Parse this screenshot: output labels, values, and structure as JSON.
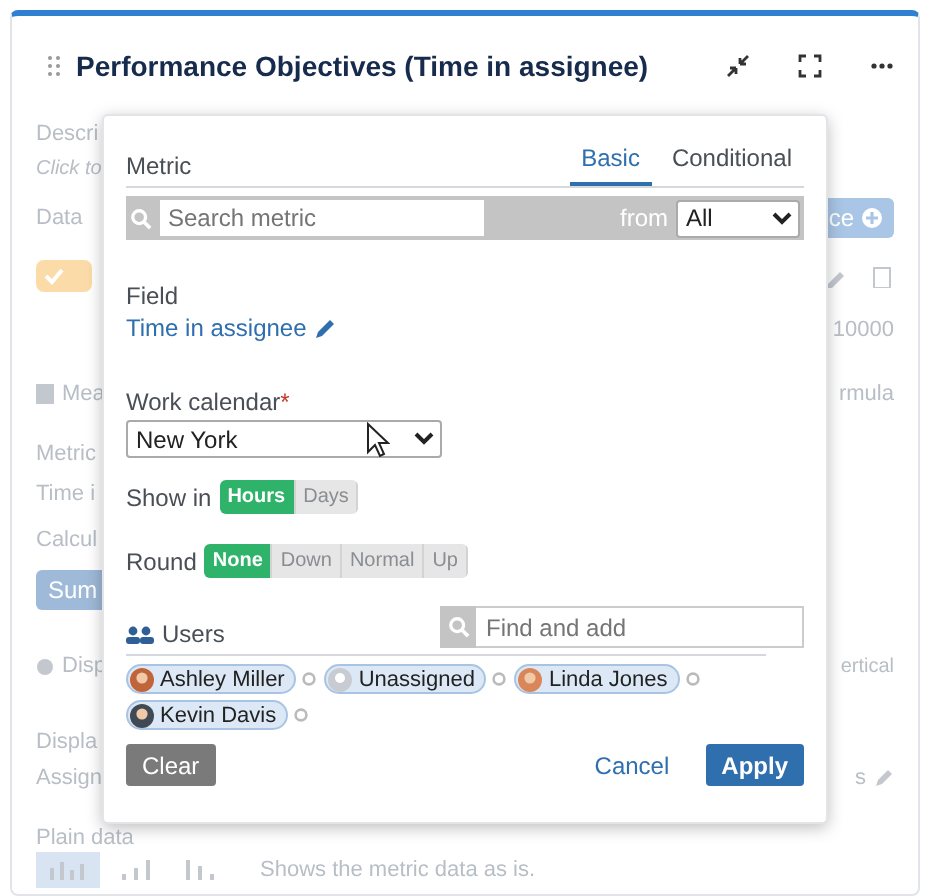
{
  "widget": {
    "title": "Performance Objectives (Time in assignee)"
  },
  "background_panel": {
    "description_label": "Descri",
    "description_hint": "Click to",
    "data_source_label": "Data",
    "add_source_button": "ce",
    "limit_value": "10000",
    "measures_label": "Mea",
    "formula_link": "rmula",
    "metric_label": "Metric",
    "metric_value": "Time i",
    "calculation_label": "Calcul",
    "sum_button": "Sum",
    "display_label": "Disp",
    "orientation_tab": "ertical",
    "display_name_label": "Displa",
    "display_name_value": "Assign",
    "display_name_tail": "s",
    "plain_data_label": "Plain data",
    "plain_data_hint": "Shows the metric data as is."
  },
  "popup": {
    "metric_label": "Metric",
    "tabs": [
      {
        "label": "Basic",
        "selected": true
      },
      {
        "label": "Conditional",
        "selected": false
      }
    ],
    "search": {
      "placeholder": "Search metric",
      "from_label": "from",
      "from_value": "All"
    },
    "field_label": "Field",
    "field_value": "Time in assignee",
    "calendar_label": "Work calendar",
    "required_mark": "*",
    "calendar_value": "New York",
    "show_in_label": "Show in",
    "show_in": [
      {
        "label": "Hours",
        "selected": true
      },
      {
        "label": "Days",
        "selected": false
      }
    ],
    "round_label": "Round",
    "round": [
      {
        "label": "None",
        "selected": true
      },
      {
        "label": "Down",
        "selected": false
      },
      {
        "label": "Normal",
        "selected": false
      },
      {
        "label": "Up",
        "selected": false
      }
    ],
    "users_label": "Users",
    "users_search": {
      "placeholder": "Find and add"
    },
    "users": [
      {
        "name": "Ashley Miller",
        "kind": "person",
        "color": "#c0643c"
      },
      {
        "name": "Unassigned",
        "kind": "unassigned",
        "color": "#c8ccd2"
      },
      {
        "name": "Linda Jones",
        "kind": "person",
        "color": "#d9875a"
      },
      {
        "name": "Kevin Davis",
        "kind": "person",
        "color": "#3f4a55"
      }
    ],
    "buttons": {
      "clear": "Clear",
      "cancel": "Cancel",
      "apply": "Apply"
    }
  }
}
